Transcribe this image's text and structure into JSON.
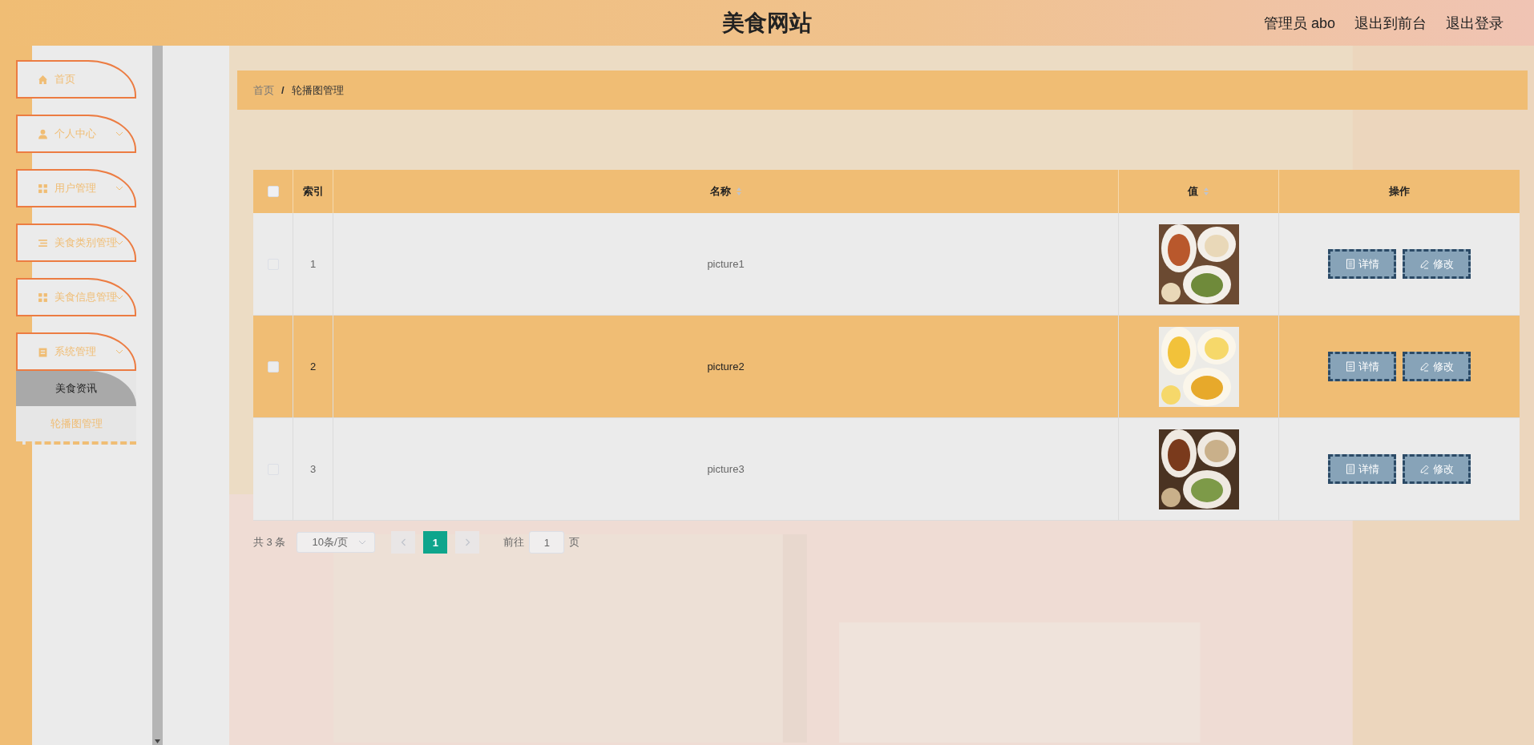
{
  "header": {
    "title": "美食网站",
    "links": [
      "管理员 abo",
      "退出到前台",
      "退出登录"
    ]
  },
  "sidebar": {
    "items": [
      {
        "label": "首页",
        "expandable": false
      },
      {
        "label": "个人中心",
        "expandable": true
      },
      {
        "label": "用户管理",
        "expandable": true
      },
      {
        "label": "美食类别管理",
        "expandable": true
      },
      {
        "label": "美食信息管理",
        "expandable": true
      },
      {
        "label": "系统管理",
        "expandable": true,
        "children": [
          {
            "label": "美食资讯",
            "selected": true
          },
          {
            "label": "轮播图管理",
            "selected": false
          }
        ]
      }
    ]
  },
  "breadcrumb": [
    "首页",
    "轮播图管理"
  ],
  "breadcrumb_separator": "/",
  "table": {
    "select_all": {
      "checked": false
    },
    "columns": [
      {
        "label": "索引",
        "sortable": false
      },
      {
        "label": "名称",
        "sortable": true
      },
      {
        "label": "值",
        "sortable": true
      },
      {
        "label": "操作",
        "sortable": false
      }
    ],
    "rows": [
      {
        "checked": false,
        "hovered": false,
        "index": "1",
        "name": "picture1",
        "value": {
          "kind": "picture"
        },
        "actions": [
          "详情",
          "修改"
        ]
      },
      {
        "checked": false,
        "hovered": true,
        "index": "2",
        "name": "picture2",
        "value": {
          "kind": "picture"
        },
        "actions": [
          "详情",
          "修改"
        ]
      },
      {
        "checked": false,
        "hovered": false,
        "index": "3",
        "name": "picture3",
        "value": {
          "kind": "picture"
        },
        "actions": [
          "详情",
          "修改"
        ]
      }
    ]
  },
  "pagination": {
    "total": "共 3 条",
    "page_size": "10条/页",
    "pages": [
      {
        "label": "1",
        "selected": true
      }
    ],
    "goto_label": "前往",
    "goto_value": "1",
    "goto_suffix": "页"
  }
}
